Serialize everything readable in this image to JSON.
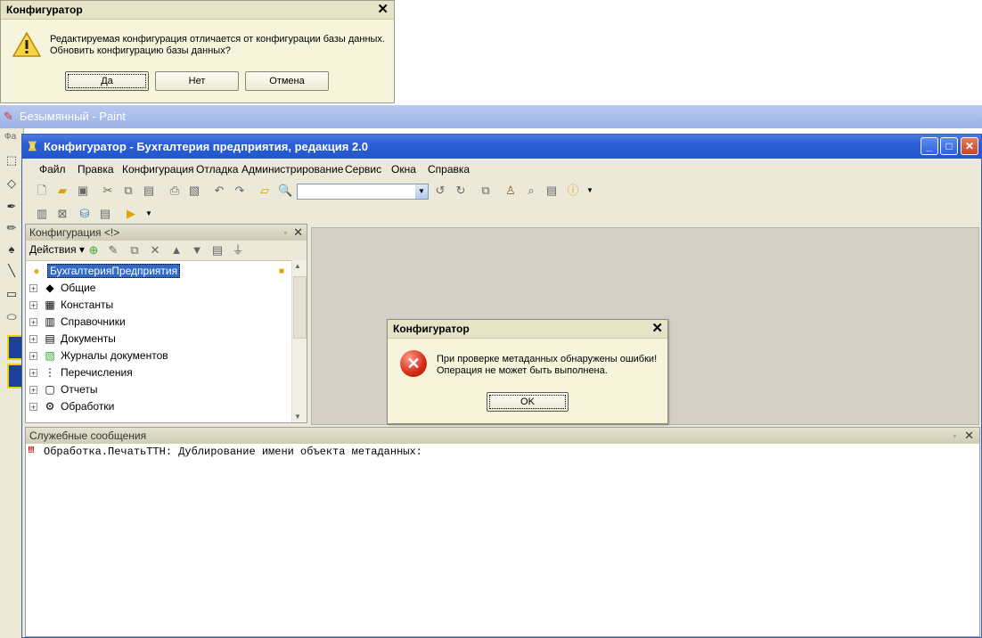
{
  "top_dialog": {
    "title": "Конфигуратор",
    "close": "✕",
    "line1": "Редактируемая конфигурация отличается от конфигурации базы данных.",
    "line2": "Обновить конфигурацию базы данных?",
    "btn_yes": "Да",
    "btn_no": "Нет",
    "btn_cancel": "Отмена"
  },
  "paint": {
    "title": "Безымянный - Paint",
    "menu_fragment": "Фа"
  },
  "configurator": {
    "title": "Конфигуратор - Бухгалтерия предприятия, редакция 2.0",
    "menu": [
      "Файл",
      "Правка",
      "Конфигурация",
      "Отладка",
      "Администрирование",
      "Сервис",
      "Окна",
      "Справка"
    ],
    "search_value": ""
  },
  "tree_panel": {
    "title": "Конфигурация <!>",
    "actions_label": "Действия",
    "root": "БухгалтерияПредприятия",
    "items": [
      {
        "label": "Общие",
        "icon": "◆"
      },
      {
        "label": "Константы",
        "icon": "▦"
      },
      {
        "label": "Справочники",
        "icon": "▥"
      },
      {
        "label": "Документы",
        "icon": "▤"
      },
      {
        "label": "Журналы документов",
        "icon": "▧"
      },
      {
        "label": "Перечисления",
        "icon": "⋮"
      },
      {
        "label": "Отчеты",
        "icon": "▢"
      },
      {
        "label": "Обработки",
        "icon": "⚙"
      }
    ]
  },
  "service_messages": {
    "title": "Служебные сообщения",
    "marker": "!!!",
    "line": "Обработка.ПечатьТТН: Дублирование имени объекта метаданных:"
  },
  "error_dialog": {
    "title": "Конфигуратор",
    "close": "✕",
    "line1": "При проверке метаданных обнаружены ошибки!",
    "line2": "Операция не может быть выполнена.",
    "btn_ok": "OK"
  }
}
